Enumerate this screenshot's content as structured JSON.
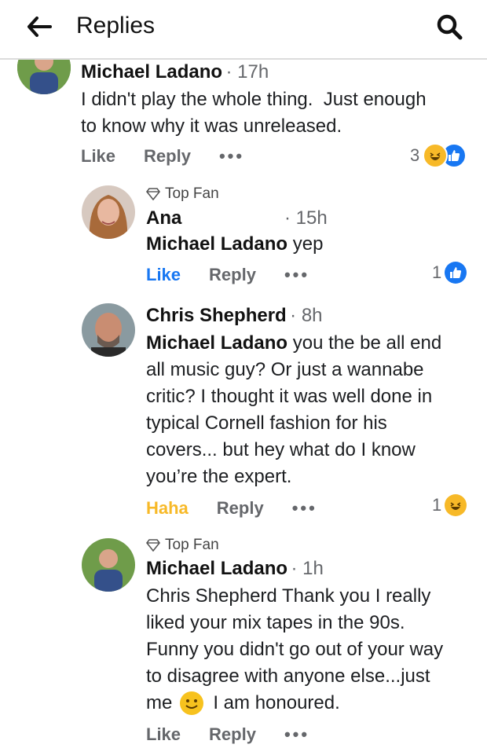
{
  "header": {
    "title": "Replies"
  },
  "colors": {
    "like_blue": "#1877f2",
    "haha_yellow": "#f7b928",
    "meta_gray": "#65676b"
  },
  "comments": [
    {
      "author": "Michael Ladano",
      "time": "17h",
      "lines": [
        "I didn't play the whole thing.  Just enough",
        "to know why it was unreleased."
      ],
      "actions": {
        "like": "Like",
        "reply": "Reply",
        "more": "•••"
      },
      "reaction_count": "3",
      "reactions": [
        "haha",
        "like"
      ]
    },
    {
      "badge": "Top Fan",
      "author": "Ana",
      "time": "15h",
      "mention": "Michael Ladano",
      "lines": [
        "yep"
      ],
      "actions": {
        "like": "Like",
        "reply": "Reply",
        "more": "•••"
      },
      "liked": true,
      "reaction_count": "1",
      "reactions": [
        "like"
      ]
    },
    {
      "author": "Chris Shepherd",
      "time": "8h",
      "mention": "Michael Ladano",
      "lines": [
        " you the be all end",
        "all music guy? Or just a wannabe",
        "critic? I thought it was well done in",
        "typical Cornell fashion for his",
        "covers... but hey what do I know",
        "you’re the expert."
      ],
      "actions": {
        "like": "Haha",
        "reply": "Reply",
        "more": "•••"
      },
      "reaction_count": "1",
      "reactions": [
        "haha"
      ]
    },
    {
      "badge": "Top Fan",
      "author": "Michael Ladano",
      "time": "1h",
      "lines": [
        "Chris Shepherd Thank you I really",
        "liked your mix tapes in the 90s.",
        "Funny you didn't go out of your way",
        "to disagree with anyone else...just"
      ],
      "last_line_before": "me",
      "last_line_after": "I am honoured.",
      "actions": {
        "like": "Like",
        "reply": "Reply",
        "more": "•••"
      }
    }
  ]
}
